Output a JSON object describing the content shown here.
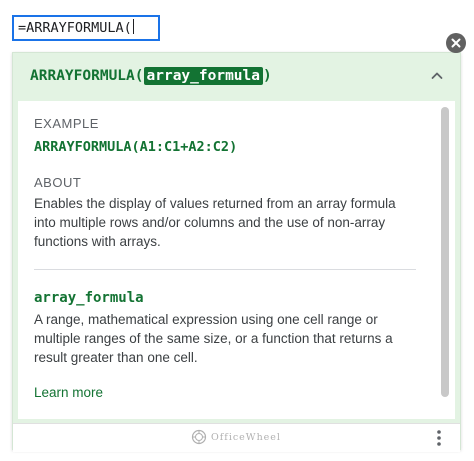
{
  "formula_bar": {
    "value": "=ARRAYFORMULA("
  },
  "help_panel": {
    "function_name": "ARRAYFORMULA(",
    "argument_highlight": "array_formula",
    "closing_paren": ")",
    "example_label": "EXAMPLE",
    "example_formula": "ARRAYFORMULA(A1:C1+A2:C2)",
    "about_label": "ABOUT",
    "about_text": "Enables the display of values returned from an array formula into multiple rows and/or columns and the use of non-array functions with arrays.",
    "argument_name": "array_formula",
    "argument_description": "A range, mathematical expression using one cell range or multiple ranges of the same size, or a function that returns a result greater than one cell.",
    "learn_more_label": "Learn more",
    "watermark_text": "OfficeWheel"
  },
  "icons": {
    "close": "close-icon",
    "collapse": "chevron-up-icon",
    "more": "more-vert-icon",
    "watermark_logo": "officewheel-logo-icon"
  },
  "colors": {
    "accent_green": "#137333",
    "panel_background": "#e3f3e3",
    "input_border": "#1a73e8",
    "close_button": "#616161"
  }
}
